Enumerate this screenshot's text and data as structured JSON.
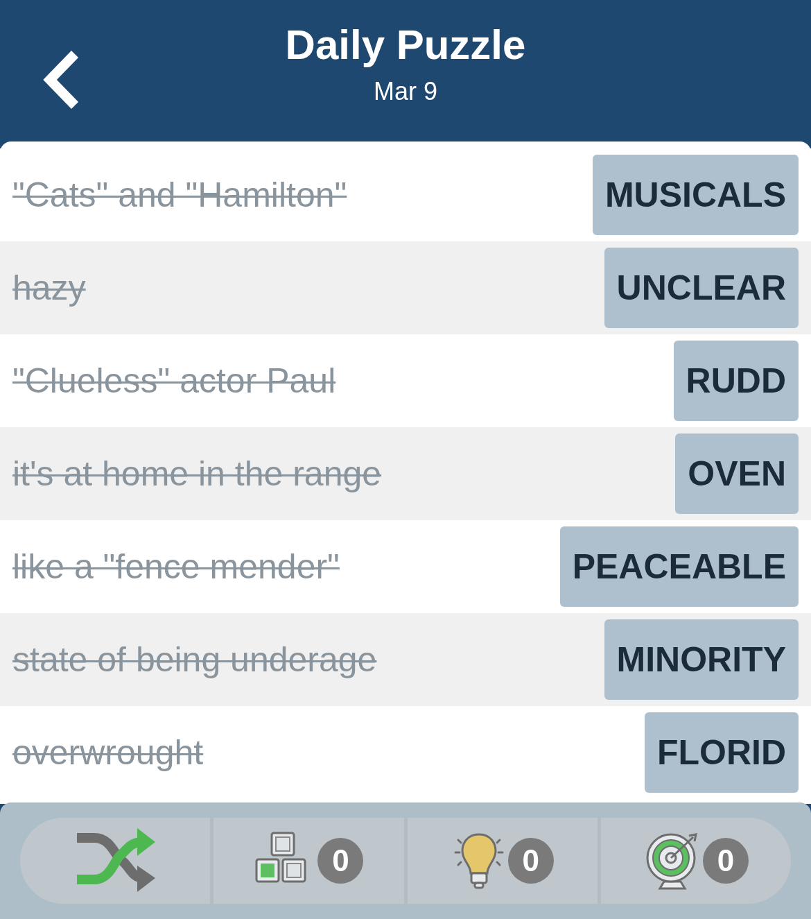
{
  "header": {
    "title": "Daily Puzzle",
    "date": "Mar 9"
  },
  "clues": [
    {
      "clue": "\"Cats\" and \"Hamilton\"",
      "answer": "MUSICALS",
      "solved": true
    },
    {
      "clue": "hazy",
      "answer": "UNCLEAR",
      "solved": true
    },
    {
      "clue": "\"Clueless\" actor Paul",
      "answer": "RUDD",
      "solved": true
    },
    {
      "clue": "it's at home in the range",
      "answer": "OVEN",
      "solved": true
    },
    {
      "clue": "like a \"fence mender\"",
      "answer": "PEACEABLE",
      "solved": true
    },
    {
      "clue": "state of being underage",
      "answer": "MINORITY",
      "solved": true
    },
    {
      "clue": "overwrought",
      "answer": "FLORID",
      "solved": true
    }
  ],
  "toolbar": [
    {
      "kind": "shuffle"
    },
    {
      "kind": "letters",
      "count": "0"
    },
    {
      "kind": "hint",
      "count": "0"
    },
    {
      "kind": "target",
      "count": "0"
    }
  ]
}
